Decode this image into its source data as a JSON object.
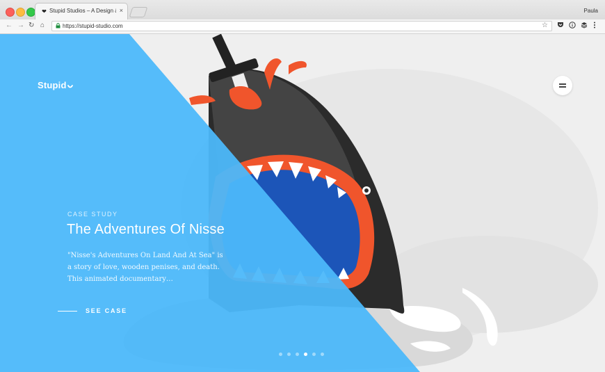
{
  "browser": {
    "tab_title": "Stupid Studios – A Design & B",
    "tab_close": "×",
    "profile_name": "Paula",
    "url": "https://stupid-studio.com",
    "nav": {
      "back": "←",
      "forward": "→",
      "reload": "↻",
      "home": "⌂",
      "star": "☆",
      "lock": "🔒"
    },
    "extensions": [
      "pocket-icon",
      "info-icon",
      "buffer-icon",
      "menu-icon"
    ]
  },
  "site": {
    "logo": "Stupid",
    "menu_icon": "hamburger-icon",
    "slide": {
      "label": "CASE STUDY",
      "title": "The Adventures Of Nisse",
      "description": "\"Nisse's Adventures On Land And At Sea\" is a story of love, wooden penises, and death. This animated documentary…",
      "cta": "SEE CASE"
    },
    "pagination": {
      "total": 6,
      "active_index": 3
    },
    "colors": {
      "panel_blue": "#4cb8fa",
      "shark_red": "#f0552c",
      "shark_black": "#2a2a2a",
      "mouth_blue": "#1c55b8"
    }
  }
}
